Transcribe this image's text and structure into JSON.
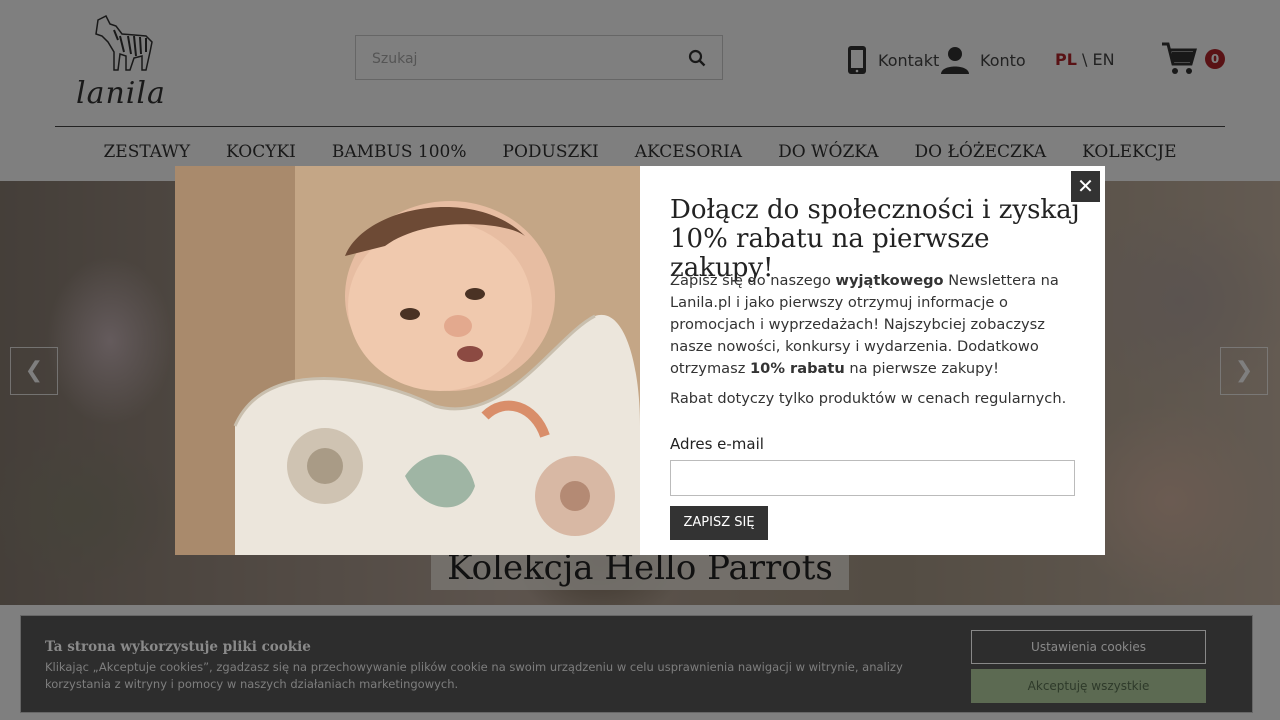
{
  "header": {
    "logo_text": "lanila",
    "search_placeholder": "Szukaj",
    "contact_label": "Kontakt",
    "account_label": "Konto",
    "lang_pl": "PL",
    "lang_sep": "\\",
    "lang_en": "EN",
    "cart_count": "0"
  },
  "nav": [
    "ZESTAWY",
    "KOCYKI",
    "BAMBUS 100%",
    "PODUSZKI",
    "AKCESORIA",
    "DO WÓZKA",
    "DO ŁÓŻECZKA",
    "KOLEKCJE"
  ],
  "hero": {
    "title": "Kolekcja Hello Parrots",
    "prev_icon": "chevron-left-icon",
    "next_icon": "chevron-right-icon"
  },
  "modal": {
    "close": "✕",
    "title": "Dołącz do społeczności i zyskaj 10% rabatu na pierwsze zakupy!",
    "text_1": "Zapisz się do naszego ",
    "text_bold_1": "wyjątkowego",
    "text_2": " Newslettera na Lanila.pl i jako pierwszy otrzymuj informacje o promocjach i wyprzedażach!  Najszybciej zobaczysz nasze nowości, konkursy i wydarzenia. Dodatkowo otrzymasz ",
    "text_bold_2": "10% rabatu",
    "text_3": " na pierwsze zakupy!",
    "text_note": "Rabat dotyczy tylko produktów w cenach regularnych.",
    "email_label": "Adres e-mail",
    "email_value": "",
    "submit_label": "ZAPISZ SIĘ"
  },
  "cookie": {
    "title": "Ta strona wykorzystuje pliki cookie",
    "text": "Klikając „Akceptuje cookies”, zgadzasz się na przechowywanie plików cookie na swoim urządzeniu w celu usprawnienia nawigacji w witrynie, analizy korzystania z witryny i pomocy w naszych działaniach marketingowych.",
    "settings_label": "Ustawienia cookies",
    "accept_label": "Akceptuję wszystkie"
  },
  "colors": {
    "accent": "#b3242a",
    "dark_button": "#333333",
    "accept_button": "#5c6a52"
  }
}
